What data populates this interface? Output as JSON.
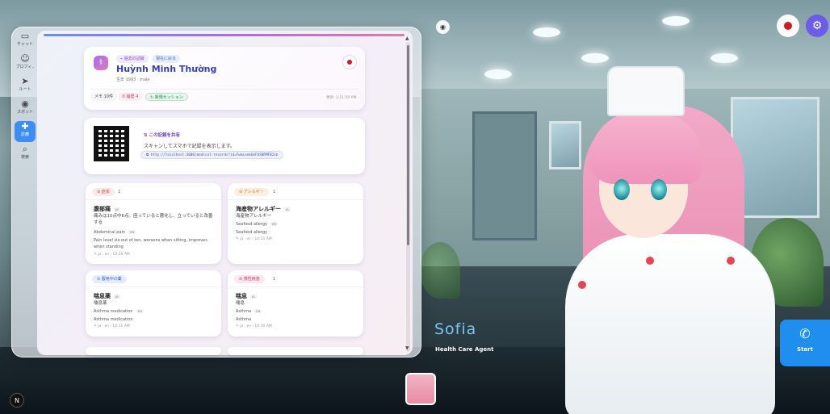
{
  "sidebar": {
    "items": [
      {
        "icon": "chat-icon",
        "glyph": "▭",
        "label": "チャット"
      },
      {
        "icon": "profile-icon",
        "glyph": "☺",
        "label": "プロフィ.."
      },
      {
        "icon": "route-icon",
        "glyph": "➤",
        "label": "ルート"
      },
      {
        "icon": "spot-icon",
        "glyph": "◉",
        "label": "スポット"
      },
      {
        "icon": "medical-icon",
        "glyph": "✚",
        "label": "診療"
      },
      {
        "icon": "search-icon",
        "glyph": "⌕",
        "label": "検索"
      }
    ],
    "active_index": 4
  },
  "patient": {
    "chip_past": "過去の記録",
    "chip_current": "現在に戻る",
    "name": "Huỳnh Minh Thường",
    "sub": "生年 1993 · male",
    "memo": "メモ 10件",
    "history": "履歴 4",
    "new_session": "新規セッション",
    "updated": "更新: 2:11:50 PM"
  },
  "qr": {
    "title": "この記録を共有",
    "desc": "スキャンしてスマホで記録を表示します。",
    "url": "http://localhost:3000/medical-records?id=Fwmcxek6eFbSBRMFB2xb"
  },
  "sections": [
    {
      "key": "symptom",
      "label": "症状",
      "count": "1",
      "head_bg": "#fde8e8",
      "head_fg": "#d0453e",
      "title": "腹部痛",
      "lang": "JA",
      "ja_detail": "痛みは10点中6点。座っていると悪化し、立っていると改善する",
      "en_title": "Abdominal pain",
      "en_lang": "EN",
      "en_detail": "Pain level six out of ten, worsens when sitting, improves when standing",
      "footer": "ja · en · 10:28 AM"
    },
    {
      "key": "allergy",
      "label": "アレルギー",
      "count": "1",
      "head_bg": "#fdeedd",
      "head_fg": "#cf7a1f",
      "title": "海産物アレルギー",
      "lang": "JA",
      "ja_detail": "海産物アレルギー",
      "en_title": "Seafood allergy",
      "en_lang": "EN",
      "en_detail": "Seafood allergy",
      "footer": "ja · en · 10:31 AM"
    },
    {
      "key": "medication",
      "label": "服用中の薬",
      "count": "1",
      "head_bg": "#e5edfd",
      "head_fg": "#3e66cf",
      "title": "喘息薬",
      "lang": "JA",
      "ja_detail": "喘息薬",
      "en_title": "Asthma medication",
      "en_lang": "EN",
      "en_detail": "Asthma medication",
      "footer": "ja · en · 10:31 AM"
    },
    {
      "key": "chronic",
      "label": "慢性疾患",
      "count": "1",
      "head_bg": "#fde6ee",
      "head_fg": "#c8376a",
      "title": "喘息",
      "lang": "JA",
      "ja_detail": "喘息",
      "en_title": "Asthma",
      "en_lang": "EN",
      "en_detail": "Asthma",
      "footer": "ja · en · 10:30 AM"
    }
  ],
  "agent": {
    "name": "Sofia",
    "role": "Health Care Agent",
    "start_label": "Start"
  },
  "misc": {
    "n_badge": "N"
  }
}
